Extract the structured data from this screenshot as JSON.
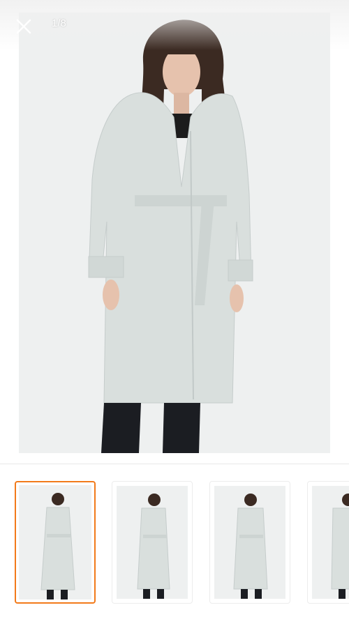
{
  "viewer": {
    "counter": "1/8",
    "close_icon": "close-icon"
  },
  "thumbnails": [
    {
      "name": "thumbnail-1",
      "selected": true
    },
    {
      "name": "thumbnail-2",
      "selected": false
    },
    {
      "name": "thumbnail-3",
      "selected": false
    },
    {
      "name": "thumbnail-4",
      "selected": false
    }
  ],
  "colors": {
    "accent": "#f27a1a",
    "photo_background": "#eef0f0",
    "coat": "#d9dfdd"
  }
}
